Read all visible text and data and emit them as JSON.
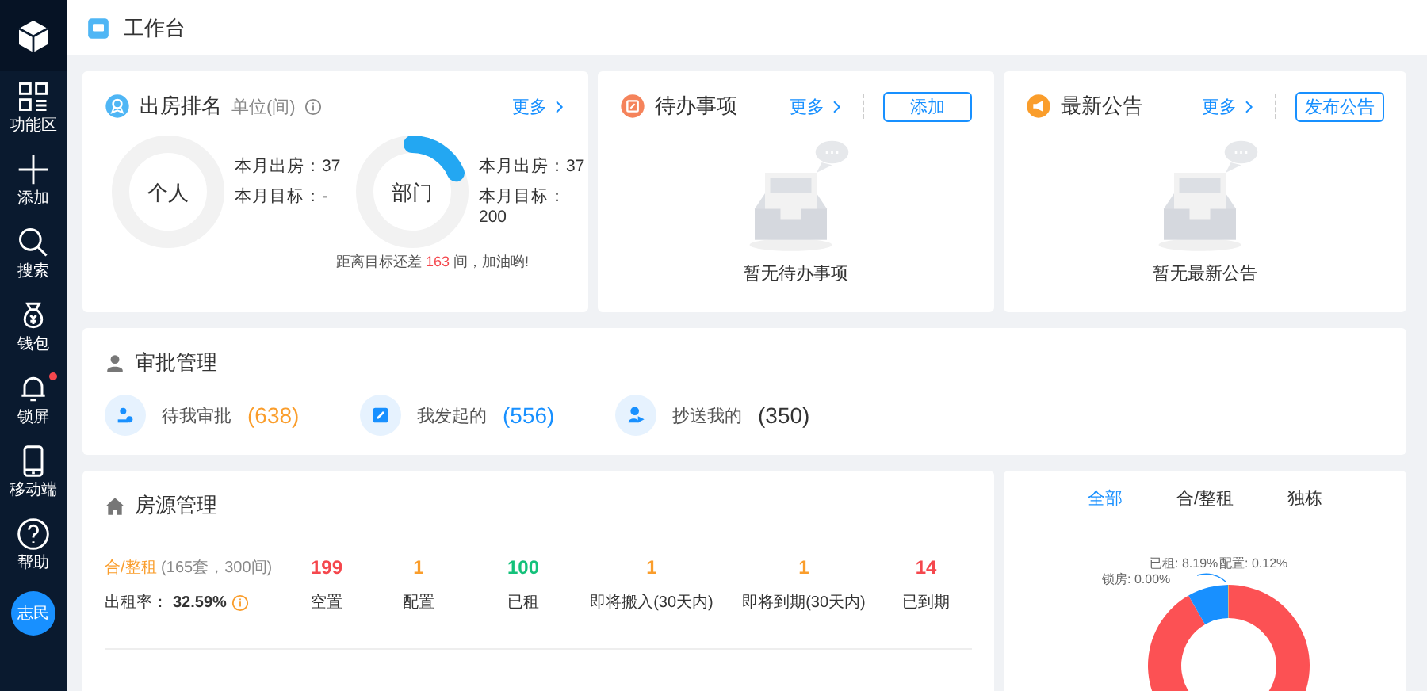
{
  "sidebar": {
    "items": [
      {
        "label": "功能区",
        "badge": false
      },
      {
        "label": "添加",
        "badge": false
      },
      {
        "label": "搜索",
        "badge": false
      },
      {
        "label": "钱包",
        "badge": false
      },
      {
        "label": "锁屏",
        "badge": true
      },
      {
        "label": "移动端",
        "badge": false
      },
      {
        "label": "帮助",
        "badge": false
      }
    ],
    "avatar": "志民"
  },
  "header": {
    "title": "工作台"
  },
  "ranking": {
    "title": "出房排名",
    "unit": "单位(间)",
    "more": "更多",
    "rings": [
      {
        "name": "个人",
        "level": 0,
        "lines": [
          "本月出房：37",
          "本月目标：-"
        ]
      },
      {
        "name": "部门",
        "level": 0.185,
        "lines": [
          "本月出房：37",
          "本月目标：200"
        ]
      }
    ],
    "note": [
      {
        "kind": "plain",
        "text": "距离目标还差 "
      },
      {
        "kind": "highlight",
        "text": "163"
      },
      {
        "kind": "plain",
        "text": " 间，加油哟!"
      }
    ]
  },
  "todo": {
    "title": "待办事项",
    "more": "更多",
    "button": "添加",
    "empty": "暂无待办事项"
  },
  "notice": {
    "title": "最新公告",
    "more": "更多",
    "button": "发布公告",
    "empty": "暂无最新公告"
  },
  "approval": {
    "title": "审批管理",
    "items": [
      {
        "label": "待我审批",
        "count": "(638)",
        "color": "#fa9d2b"
      },
      {
        "label": "我发起的",
        "count": "(556)",
        "color": "#1890ff"
      },
      {
        "label": "抄送我的",
        "count": "(350)",
        "color": "#333333"
      }
    ]
  },
  "housing": {
    "title": "房源管理",
    "type": "合/整租",
    "summary": "(165套，300间)",
    "rate_label": "出租率：",
    "rate": "32.59%",
    "stats": [
      {
        "value": "199",
        "label": "空置",
        "color": "#f5474d"
      },
      {
        "value": "1",
        "label": "配置",
        "color": "#fa9d2b"
      },
      {
        "value": "100",
        "label": "已租",
        "color": "#13c17a"
      },
      {
        "value": "1",
        "label": "即将搬入(30天内)",
        "color": "#fa9d2b"
      },
      {
        "value": "1",
        "label": "即将到期(30天内)",
        "color": "#fa9d2b"
      },
      {
        "value": "14",
        "label": "已到期",
        "color": "#f5474d"
      }
    ]
  },
  "breakdown": {
    "tabs": [
      {
        "label": "全部",
        "selected": true
      },
      {
        "label": "合/整租",
        "selected": false
      },
      {
        "label": "独栋",
        "selected": false
      }
    ],
    "slice_labels": [
      "已租: 8.19%",
      "配置: 0.12%",
      "锁房: 0.00%"
    ]
  }
}
